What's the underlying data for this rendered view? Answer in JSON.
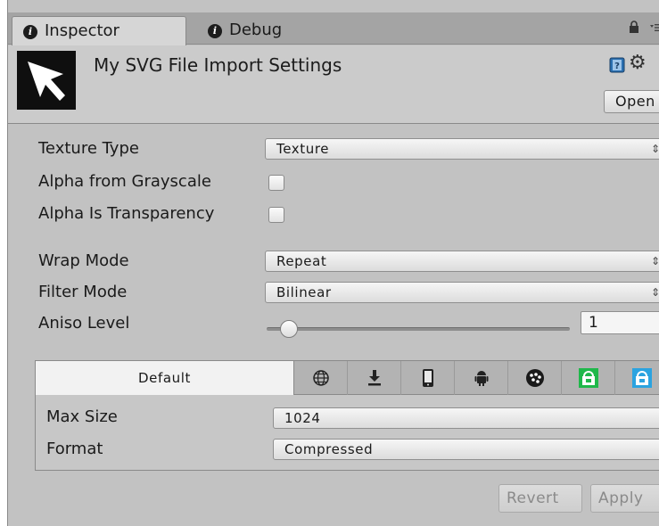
{
  "tabs": {
    "inspector": "Inspector",
    "debug": "Debug"
  },
  "header": {
    "title": "My SVG File Import Settings",
    "open_button": "Open"
  },
  "fields": {
    "texture_type": {
      "label": "Texture Type",
      "value": "Texture"
    },
    "alpha_from_grayscale": {
      "label": "Alpha from Grayscale",
      "checked": false
    },
    "alpha_is_transparency": {
      "label": "Alpha Is Transparency",
      "checked": false
    },
    "wrap_mode": {
      "label": "Wrap Mode",
      "value": "Repeat"
    },
    "filter_mode": {
      "label": "Filter Mode",
      "value": "Bilinear"
    },
    "aniso_level": {
      "label": "Aniso Level",
      "value": "1"
    }
  },
  "platform": {
    "default_tab": "Default",
    "icons": [
      "globe-icon",
      "download-icon",
      "phone-icon",
      "android-icon",
      "blackberry-icon",
      "windows-store-icon",
      "windows-store-icon"
    ],
    "max_size": {
      "label": "Max Size",
      "value": "1024"
    },
    "format": {
      "label": "Format",
      "value": "Compressed"
    }
  },
  "buttons": {
    "revert": "Revert",
    "apply": "Apply"
  },
  "colors": {
    "panel_bg": "#c2c2c2",
    "store_green": "#1fb84a",
    "store_blue": "#2ba3e0"
  }
}
